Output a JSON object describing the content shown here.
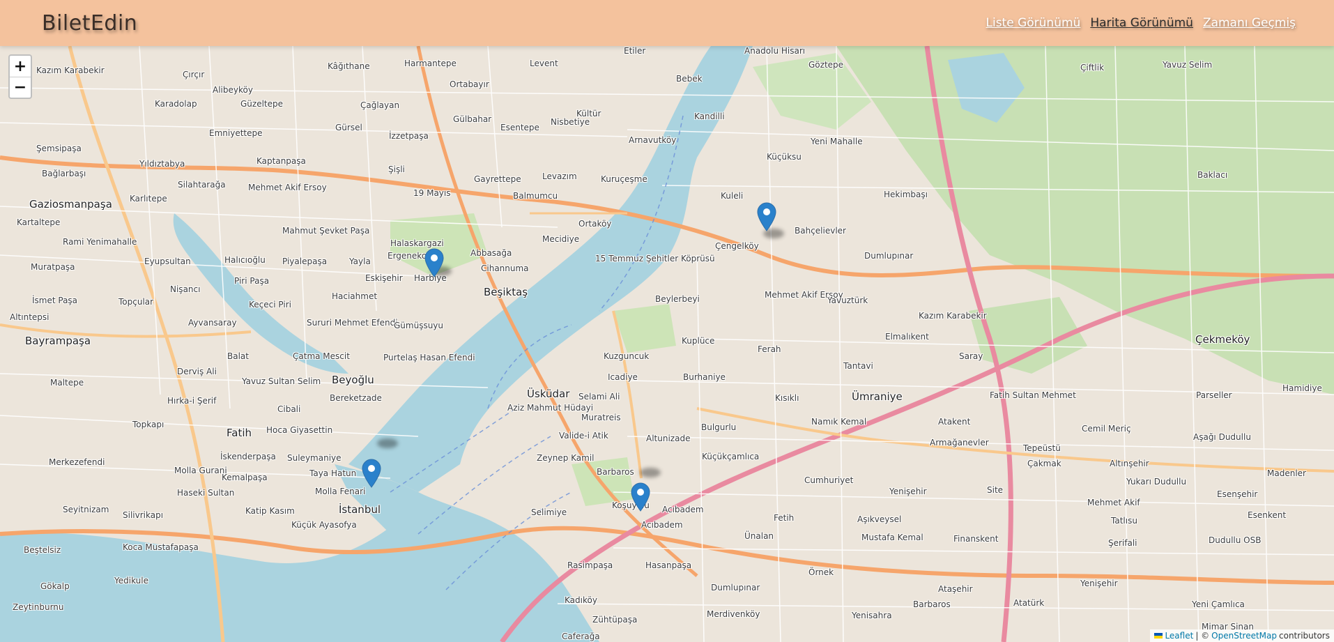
{
  "app": {
    "brand": "BiletEdin"
  },
  "nav": {
    "links": [
      {
        "label": "Liste Görünümü",
        "active": false
      },
      {
        "label": "Harita Görünümü",
        "active": true
      },
      {
        "label": "Zamanı Geçmiş",
        "active": false
      }
    ]
  },
  "map": {
    "zoom_in": "+",
    "zoom_out": "−",
    "attribution": {
      "leaflet": "Leaflet",
      "separator": "| ©",
      "osm": "OpenStreetMap",
      "suffix": "contributors"
    },
    "marker_color": "#2a81cb",
    "marker_count": 4,
    "labels": {
      "kagithane": "Kâğıthane",
      "harmantepe": "Harmantepe",
      "levent": "Levent",
      "etiler": "Etiler",
      "anadolu_hisari": "Anadolu Hisarı",
      "goztepe": "Göztepe",
      "ciftlik": "Çiftlik",
      "yavuz_selim": "Yavuz Selim",
      "kazim_karabekir_w": "Kazım Karabekir",
      "circir": "Çırçır",
      "alibeykoy": "Alibeyköy",
      "ortabayir": "Ortabayır",
      "bebek": "Bebek",
      "karadolap": "Karadolap",
      "guzeltepe": "Güzeltepe",
      "caglayan": "Çağlayan",
      "gulbahar": "Gülbahar",
      "kultur": "Kültür",
      "kandilli": "Kandilli",
      "emniyettepe": "Emniyettepe",
      "gursel": "Gürsel",
      "esentepe": "Esentepe",
      "nisbetiye": "Nisbetiye",
      "arnavutkoy": "Arnavutköy",
      "yeni_mahalle": "Yeni Mahalle",
      "semsipasa": "Şemsipaşa",
      "izzetpasa": "İzzetpaşa",
      "yildiztabya": "Yıldıztabya",
      "kaptanpasa": "Kaptanpaşa",
      "sisli": "Şişli",
      "kucuksu": "Küçüksu",
      "baglarbasi_w": "Bağlarbaşı",
      "silahtaraga": "Silahtarağa",
      "mehmet_akif_ersoy_w": "Mehmet Akif Ersoy",
      "gayrettepe": "Gayrettepe",
      "levazim": "Levazım",
      "kurucesme": "Kuruçeşme",
      "baklaci": "Baklacı",
      "gaziosmanpasa": "Gaziosmanpaşa",
      "karlitepe": "Karlıtepe",
      "mayis19": "19 Mayıs",
      "balmumcu": "Balmumcu",
      "kuleli": "Kuleli",
      "hekimbasi": "Hekimbaşı",
      "kartaltepe": "Kartaltepe",
      "mahmut_sevket_pasa": "Mahmut Şevket Paşa",
      "halaskargazi": "Halaskargazi",
      "ortakoy": "Ortaköy",
      "bahcelievler": "Bahçelievler",
      "rami_yenimahalle": "Rami Yenimahalle",
      "ergenekon": "Ergenekon",
      "abbasaga": "Abbasağa",
      "mecidiye": "Mecidiye",
      "cengelkoy": "Çengelköy",
      "dumlupinar_n": "Dumlupınar",
      "muratpasa": "Muratpaşa",
      "eyupsultan": "Eyupsultan",
      "halicioglu": "Halıcıoğlu",
      "piyalepasa": "Piyalepaşa",
      "yayla": "Yayla",
      "eskisehir": "Eskişehir",
      "harbiye": "Harbiye",
      "cihannuma": "Cihannuma",
      "bridge_15": "15 Temmuz Şehitler Köprüsü",
      "piri_pasa": "Piri Paşa",
      "ismet_pasa": "İsmet Paşa",
      "topcular": "Topçular",
      "nisanci": "Nişancı",
      "haciahmet": "Haciahmet",
      "besiktas": "Beşiktaş",
      "beylerbeyi": "Beylerbeyi",
      "mehmet_akif_ersoy_e": "Mehmet Akif Ersoy",
      "yavuzturk": "Yavuztürk",
      "altintepsi": "Altıntepsi",
      "kececi_piri": "Keçeci Piri",
      "ayvansaray": "Ayvansaray",
      "sururi": "Sururi Mehmet Efendi",
      "gumussuyu": "Gümüşsuyu",
      "kazim_karabekir_e": "Kazım Karabekir",
      "bayrampasa": "Bayrampaşa",
      "kuplu": "Kuplüce",
      "ferah": "Ferah",
      "elmalikent": "Elmalıkent",
      "cekmekoy": "Çekmeköy",
      "catma_mescit": "Çatma Mescit",
      "purtelas": "Purtelaş Hasan Efendi",
      "balat": "Balat",
      "kuzguncuk": "Kuzguncuk",
      "tantavi": "Tantavi",
      "saray": "Saray",
      "dervis_ali": "Derviş Ali",
      "beyoglu": "Beyoğlu",
      "icadiye": "Icadiye",
      "burhaniye": "Burhaniye",
      "maltepe": "Maltepe",
      "yavuz_sultan_selim": "Yavuz Sultan Selim",
      "uskudar": "Üsküdar",
      "kisikli": "Kısıklı",
      "umraniye": "Ümraniye",
      "parseller": "Parseller",
      "hamidiye": "Hamidiye",
      "hirka_i_serif": "Hırka-i Şerif",
      "bereketzade": "Bereketzade",
      "selami_ali": "Selami Ali",
      "fatih_sultan_mehmet": "Fatih Sultan Mehmet",
      "cibali": "Cibali",
      "aziz_mahmut_hudayi": "Aziz Mahmut Hüdayi",
      "namik_kemal": "Namık Kemal",
      "atakent": "Atakent",
      "topkapi": "Topkapı",
      "muratreis": "Muratreis",
      "bulgurlu": "Bulgurlu",
      "cemil_meric": "Cemil Meriç",
      "fatih": "Fatih",
      "hoca_giyasettin": "Hoca Giyasettin",
      "valide_i_atik": "Valide-i Atik",
      "altunizade": "Altunizade",
      "armaganevler": "Armağanevler",
      "asagi_dudullu": "Aşağı Dudullu",
      "tepeustu": "Tepeüstü",
      "merkezefendi": "Merkezefendi",
      "iskenderpasa": "İskenderpaşa",
      "suleymaniye": "Suleymaniye",
      "zeynep_kamil": "Zeynep Kamil",
      "kucukcamlica": "Küçükçamlıca",
      "cakmak": "Çakmak",
      "altinsehir": "Altınşehir",
      "madenler": "Madenler",
      "molla_gurani": "Molla Gurani",
      "kemalpasa": "Kemalpaşa",
      "taya_hatun": "Taya Hatun",
      "barbaros_w": "Barbaros",
      "cumhuriyet": "Cumhuriyet",
      "yenisehir_n": "Yenişehir",
      "site": "Site",
      "yukari_dudullu": "Yukarı Dudullu",
      "esensehir": "Esenşehir",
      "haseki_sultan": "Haseki Sultan",
      "molla_fenari": "Molla Fenari",
      "koşuyolu": "Koşuyolu",
      "seyitnizam": "Seyitnizam",
      "istanbul": "İstanbul",
      "selimiye": "Selimiye",
      "acibadem_n": "Acıbadem",
      "fetih": "Fetih",
      "asikveysel": "Aşıkveysel",
      "mehmet_akif_e": "Mehmet Akif",
      "silivrikapi": "Silivrikapı",
      "katip_kasim": "Katip Kasım",
      "tatlisu": "Tatlısu",
      "esenkent": "Esenkent",
      "kucuk_ayasofya": "Küçük Ayasofya",
      "acibadem_s": "Acıbadem",
      "unalan": "Ünalan",
      "mustafa_kemal": "Mustafa Kemal",
      "finanskent": "Finanskent",
      "serifali": "Şerifali",
      "dudullu_osb": "Dudullu OSB",
      "kocamustafapasa": "Koca Mustafapaşa",
      "besteltsiz": "Beştelsiz",
      "rasimpasa": "Rasimpaşa",
      "hasanpasa": "Hasanpaşa",
      "ornek": "Örnek",
      "yedikule": "Yedikule",
      "sokak": "Gökalp",
      "dumlupinar_s": "Dumlupınar",
      "atasehir": "Ataşehir",
      "yenisehir_s": "Yenişehir",
      "zeytinburnu": "Zeytinburnu",
      "kadikoy": "Kadıköy",
      "merdivenkoy": "Merdivenköy",
      "yenisahra": "Yenisahra",
      "barbaros_s": "Barbaros",
      "ataturk": "Atatürk",
      "yeni_camlica": "Yeni Çamlıca",
      "zuhtupasa": "Zühtüpaşa",
      "caferaga": "Caferağa",
      "mimar_sinan": "Mimar Sinan"
    }
  }
}
